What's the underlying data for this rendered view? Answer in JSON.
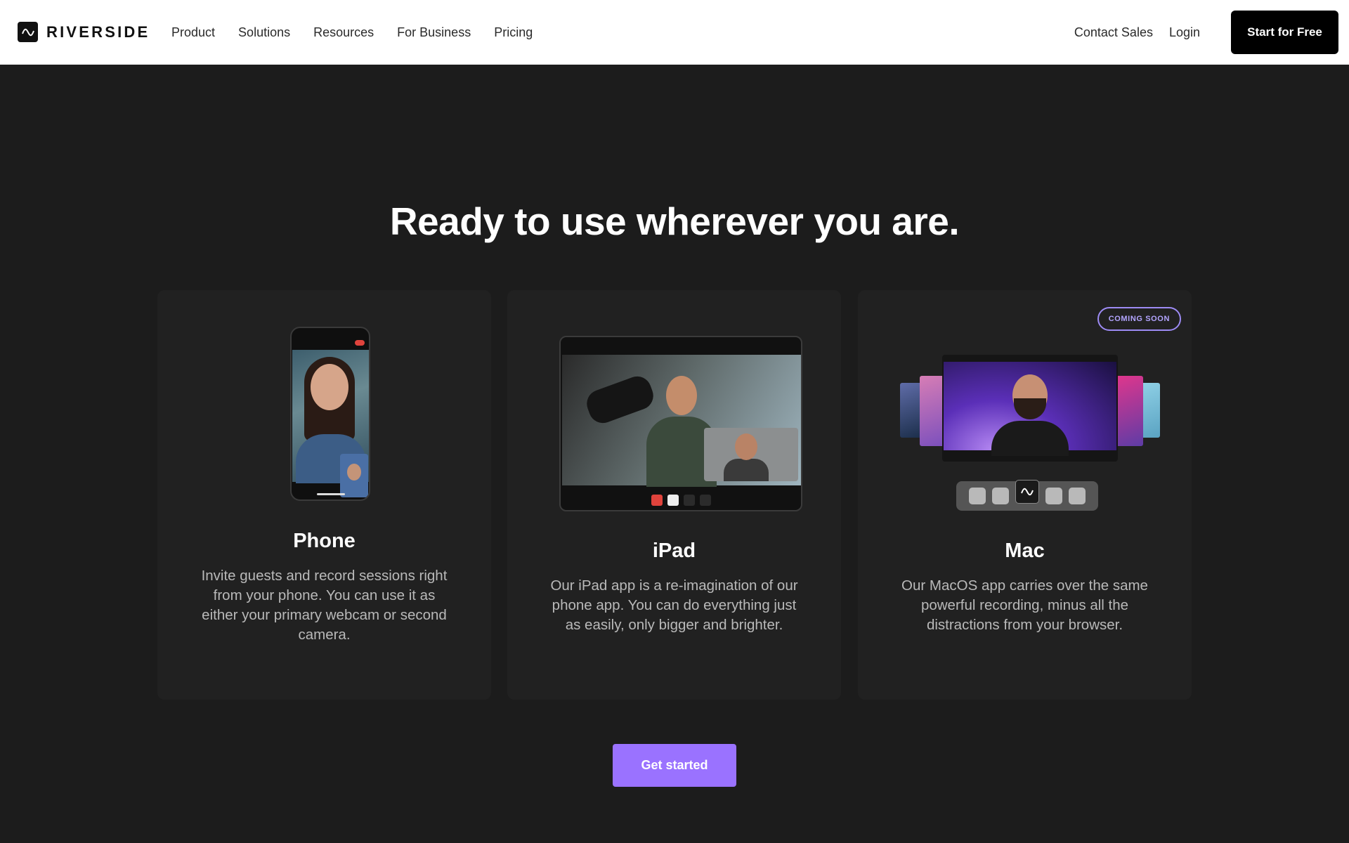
{
  "nav": {
    "logo_text": "RIVERSIDE",
    "links": [
      "Product",
      "Solutions",
      "Resources",
      "For Business",
      "Pricing"
    ],
    "contact_sales": "Contact Sales",
    "login": "Login",
    "start_button": "Start for Free"
  },
  "headline": "Ready to use wherever you are.",
  "cards": [
    {
      "title": "Phone",
      "text": "Invite guests and record sessions right from your phone. You can use it as either your primary webcam or second camera."
    },
    {
      "title": "iPad",
      "text": "Our iPad app is a re-imagination of our phone app. You can do everything just as easily, only bigger and brighter."
    },
    {
      "title": "Mac",
      "badge": "COMING SOON",
      "text": "Our MacOS app carries over the same powerful recording, minus all the distractions from your browser."
    }
  ],
  "cta": "Get started",
  "colors": {
    "background": "#1c1c1c",
    "card": "#212121",
    "accent": "#9a72ff",
    "nav_bg": "#ffffff"
  }
}
